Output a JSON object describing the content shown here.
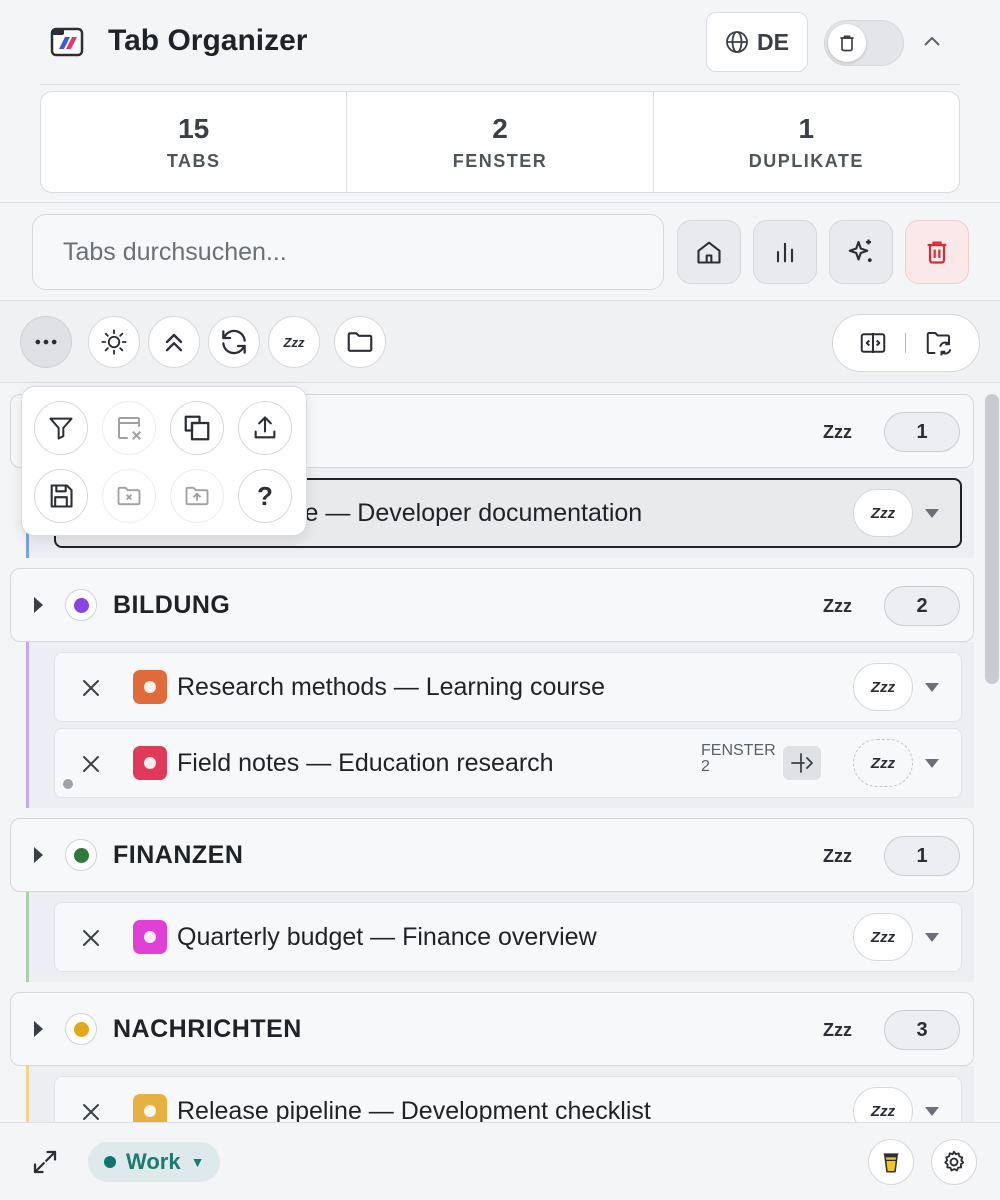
{
  "header": {
    "title": "Tab Organizer",
    "language": "DE"
  },
  "stats": [
    {
      "value": "15",
      "label": "TABS"
    },
    {
      "value": "2",
      "label": "FENSTER"
    },
    {
      "value": "1",
      "label": "DUPLIKATE"
    }
  ],
  "search": {
    "placeholder": "Tabs durchsuchen..."
  },
  "toolbar": {
    "sleep_label": "Zzz"
  },
  "popover": {
    "help_label": "?"
  },
  "groups": [
    {
      "name": "",
      "zzz": "Zzz",
      "count": "1",
      "color": "#7aa2e8",
      "tabs": [
        {
          "title": "ce — Developer documentation",
          "zzz": "Zzz",
          "active": true
        }
      ]
    },
    {
      "name": "BILDUNG",
      "zzz": "Zzz",
      "count": "2",
      "color": "#8b44e0",
      "tabs": [
        {
          "title": "Research methods — Learning course",
          "zzz": "Zzz",
          "favicon_color": "#e06a3a"
        },
        {
          "title": "Field notes — Education research",
          "zzz": "Zzz",
          "favicon_color": "#e03a5a",
          "window_label": "FENSTER",
          "window_number": "2"
        }
      ]
    },
    {
      "name": "FINANZEN",
      "zzz": "Zzz",
      "count": "1",
      "color": "#2f7a3a",
      "tabs": [
        {
          "title": "Quarterly budget — Finance overview",
          "zzz": "Zzz",
          "favicon_color": "#e040d6"
        }
      ]
    },
    {
      "name": "NACHRICHTEN",
      "zzz": "Zzz",
      "count": "3",
      "color": "#e0a81a",
      "tabs": [
        {
          "title": "Release pipeline — Development checklist",
          "zzz": "Zzz",
          "favicon_color": "#e8b040"
        }
      ]
    }
  ],
  "footer": {
    "profile": "Work",
    "profile_color": "#0f766e"
  }
}
